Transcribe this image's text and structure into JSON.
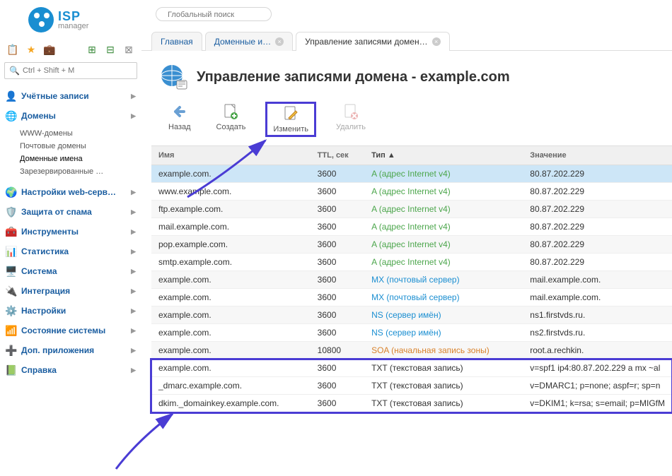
{
  "logo": {
    "brand": "ISP",
    "sub": "manager"
  },
  "search": {
    "placeholder": "Ctrl + Shift + M"
  },
  "global_search": {
    "placeholder": "Глобальный поиск"
  },
  "nav": [
    {
      "icon": "👤",
      "label": "Учётные записи",
      "key": "accounts"
    },
    {
      "icon": "🌐",
      "label": "Домены",
      "active": true,
      "key": "domains",
      "sub": [
        {
          "label": "WWW-домены"
        },
        {
          "label": "Почтовые домены"
        },
        {
          "label": "Доменные имена",
          "active": true
        },
        {
          "label": "Зарезервированные …"
        }
      ]
    },
    {
      "icon": "🌍",
      "label": "Настройки web-серв…",
      "key": "webserver"
    },
    {
      "icon": "🛡️",
      "label": "Защита от спама",
      "key": "spam"
    },
    {
      "icon": "🧰",
      "label": "Инструменты",
      "key": "tools"
    },
    {
      "icon": "📊",
      "label": "Статистика",
      "key": "stats"
    },
    {
      "icon": "🖥️",
      "label": "Система",
      "key": "system"
    },
    {
      "icon": "🔌",
      "label": "Интеграция",
      "key": "integration"
    },
    {
      "icon": "⚙️",
      "label": "Настройки",
      "key": "settings"
    },
    {
      "icon": "📶",
      "label": "Состояние системы",
      "key": "status"
    },
    {
      "icon": "➕",
      "label": "Доп. приложения",
      "key": "addons"
    },
    {
      "icon": "📗",
      "label": "Справка",
      "key": "help"
    }
  ],
  "tabs": [
    {
      "label": "Главная",
      "active": false
    },
    {
      "label": "Доменные и…",
      "active": false,
      "close": true
    },
    {
      "label": "Управление записями домен…",
      "active": true,
      "close": true
    }
  ],
  "page": {
    "title": "Управление записями домена - example.com"
  },
  "actions": {
    "back": "Назад",
    "create": "Создать",
    "edit": "Изменить",
    "delete": "Удалить"
  },
  "columns": {
    "name": "Имя",
    "ttl": "TTL, сек",
    "type": "Тип",
    "value": "Значение",
    "sort": "▲"
  },
  "rows": [
    {
      "name": "example.com.",
      "ttl": "3600",
      "type": "A (адрес Internet v4)",
      "tclass": "link-green",
      "value": "80.87.202.229",
      "selected": true
    },
    {
      "name": "www.example.com.",
      "ttl": "3600",
      "type": "A (адрес Internet v4)",
      "tclass": "link-green",
      "value": "80.87.202.229"
    },
    {
      "name": "ftp.example.com.",
      "ttl": "3600",
      "type": "A (адрес Internet v4)",
      "tclass": "link-green",
      "value": "80.87.202.229"
    },
    {
      "name": "mail.example.com.",
      "ttl": "3600",
      "type": "A (адрес Internet v4)",
      "tclass": "link-green",
      "value": "80.87.202.229"
    },
    {
      "name": "pop.example.com.",
      "ttl": "3600",
      "type": "A (адрес Internet v4)",
      "tclass": "link-green",
      "value": "80.87.202.229"
    },
    {
      "name": "smtp.example.com.",
      "ttl": "3600",
      "type": "A (адрес Internet v4)",
      "tclass": "link-green",
      "value": "80.87.202.229"
    },
    {
      "name": "example.com.",
      "ttl": "3600",
      "type": "MX (почтовый сервер)",
      "tclass": "link",
      "value": "mail.example.com."
    },
    {
      "name": "example.com.",
      "ttl": "3600",
      "type": "MX (почтовый сервер)",
      "tclass": "link",
      "value": "mail.example.com."
    },
    {
      "name": "example.com.",
      "ttl": "3600",
      "type": "NS (сервер имён)",
      "tclass": "link",
      "value": "ns1.firstvds.ru."
    },
    {
      "name": "example.com.",
      "ttl": "3600",
      "type": "NS (сервер имён)",
      "tclass": "link",
      "value": "ns2.firstvds.ru."
    },
    {
      "name": "example.com.",
      "ttl": "10800",
      "type": "SOA (начальная запись зоны)",
      "tclass": "link-orange",
      "value": "root.a.rechkin."
    },
    {
      "name": "example.com.",
      "ttl": "3600",
      "type": "TXT (текстовая запись)",
      "tclass": "",
      "value": "v=spf1 ip4:80.87.202.229 a mx ~al",
      "hg": true
    },
    {
      "name": "_dmarc.example.com.",
      "ttl": "3600",
      "type": "TXT (текстовая запись)",
      "tclass": "",
      "value": "v=DMARC1; p=none; aspf=r; sp=n",
      "hg": true
    },
    {
      "name": "dkim._domainkey.example.com.",
      "ttl": "3600",
      "type": "TXT (текстовая запись)",
      "tclass": "",
      "value": "v=DKIM1; k=rsa; s=email; p=MIGfM",
      "hg": true
    }
  ]
}
